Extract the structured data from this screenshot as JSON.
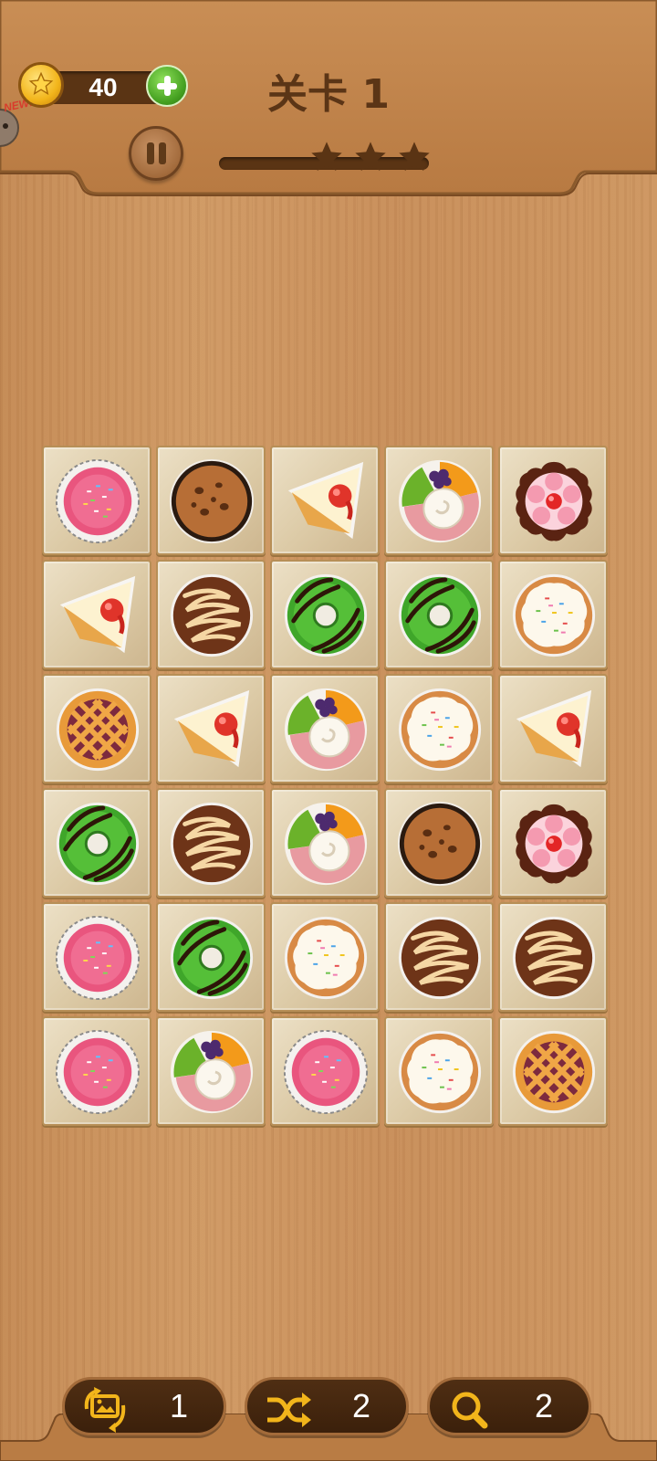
{
  "header": {
    "coins": "40",
    "level_title": "关卡 1",
    "new_label": "NEW!"
  },
  "progress": {
    "value": 0,
    "stars_total": 3,
    "stars_earned": 0
  },
  "board": {
    "columns": 5,
    "rows": 6,
    "tiles": [
      [
        "pink-cupcake",
        "chocolate-chip-cookie",
        "cheesecake-slice",
        "fruit-tart",
        "flower-tart"
      ],
      [
        "cheesecake-slice",
        "caramel-drizzle-cake",
        "green-donut",
        "green-donut",
        "sprinkle-cookie"
      ],
      [
        "lattice-pie",
        "cheesecake-slice",
        "fruit-tart",
        "sprinkle-cookie",
        "cheesecake-slice"
      ],
      [
        "green-donut",
        "caramel-drizzle-cake",
        "fruit-tart",
        "chocolate-chip-cookie",
        "flower-tart"
      ],
      [
        "pink-cupcake",
        "green-donut",
        "sprinkle-cookie",
        "caramel-drizzle-cake",
        "caramel-drizzle-cake"
      ],
      [
        "pink-cupcake",
        "fruit-tart",
        "pink-cupcake",
        "sprinkle-cookie",
        "lattice-pie"
      ]
    ]
  },
  "tools": {
    "refresh": {
      "icon": "image-refresh-icon",
      "count": "1"
    },
    "shuffle": {
      "icon": "shuffle-icon",
      "count": "2"
    },
    "hint": {
      "icon": "magnifier-icon",
      "count": "2"
    }
  },
  "colors": {
    "wood": "#c88e5a",
    "tile": "#dccaa6",
    "title": "#5b3516",
    "tool_bg": "#3b200b",
    "icon_gold": "#f2b51b"
  }
}
